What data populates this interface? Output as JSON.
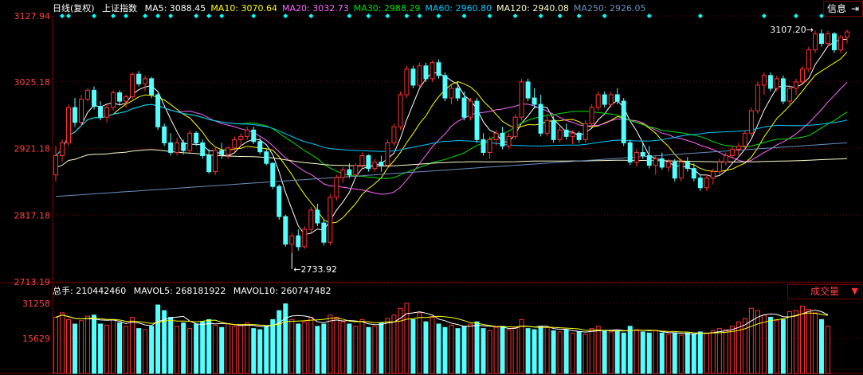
{
  "header": {
    "period_label": "日线(复权)",
    "index_name": "上证指数",
    "ma": [
      {
        "label": "MA5: 3088.45",
        "color": "#ffffff"
      },
      {
        "label": "MA10: 3070.64",
        "color": "#ffff00"
      },
      {
        "label": "MA20: 3032.73",
        "color": "#ff66ff"
      },
      {
        "label": "MA30: 2988.29",
        "color": "#00e000"
      },
      {
        "label": "MA60: 2960.80",
        "color": "#00c8ff"
      },
      {
        "label": "MA120: 2940.08",
        "color": "#ffffcc"
      },
      {
        "label": "MA250: 2926.05",
        "color": "#6a8fbf"
      }
    ],
    "info_button": "信息",
    "info_icon": "exit-arrow-icon"
  },
  "volume_header": {
    "total": "总手: 210442460",
    "mavol5": "MAVOL5: 268181922",
    "mavol10": "MAVOL10: 260747482",
    "selector_label": "成交量",
    "selector_icon": "dropdown-triangle-icon"
  },
  "colors": {
    "up": "#ff3232",
    "down": "#54ffff",
    "grid": "#7a0000",
    "axis_text": "#ff4040",
    "bg": "#000000",
    "marker": "#00ffff"
  },
  "chart_data": [
    {
      "type": "candlestick",
      "title": "上证指数",
      "y_ticks": [
        "3127.94",
        "3025.18",
        "2921.18",
        "2817.18",
        "2713.19"
      ],
      "ylim": [
        2713.19,
        3127.94
      ],
      "annotations": [
        {
          "label": "3107.20",
          "kind": "high"
        },
        {
          "label": "2733.92",
          "kind": "low"
        }
      ],
      "ohlc": [
        [
          2880,
          2925,
          2870,
          2910
        ],
        [
          2910,
          2935,
          2900,
          2930
        ],
        [
          2930,
          2990,
          2925,
          2985
        ],
        [
          2985,
          3000,
          2955,
          2962
        ],
        [
          2962,
          3005,
          2955,
          2998
        ],
        [
          2998,
          3015,
          2995,
          3012
        ],
        [
          3012,
          3018,
          2982,
          2987
        ],
        [
          2987,
          2995,
          2965,
          2970
        ],
        [
          2970,
          2990,
          2962,
          2985
        ],
        [
          2985,
          3012,
          2980,
          3008
        ],
        [
          3008,
          3012,
          2990,
          2995
        ],
        [
          2995,
          3005,
          2985,
          3002
        ],
        [
          3002,
          3040,
          2998,
          3037
        ],
        [
          3037,
          3042,
          3018,
          3022
        ],
        [
          3022,
          3035,
          3010,
          3030
        ],
        [
          3030,
          3033,
          3000,
          3005
        ],
        [
          3005,
          3008,
          2950,
          2955
        ],
        [
          2955,
          2960,
          2925,
          2930
        ],
        [
          2930,
          2945,
          2910,
          2915
        ],
        [
          2915,
          2938,
          2910,
          2930
        ],
        [
          2930,
          2935,
          2912,
          2918
        ],
        [
          2918,
          2950,
          2915,
          2945
        ],
        [
          2945,
          2948,
          2925,
          2930
        ],
        [
          2930,
          2935,
          2905,
          2910
        ],
        [
          2910,
          2920,
          2882,
          2885
        ],
        [
          2885,
          2925,
          2880,
          2918
        ],
        [
          2918,
          2930,
          2905,
          2912
        ],
        [
          2912,
          2925,
          2905,
          2922
        ],
        [
          2922,
          2940,
          2915,
          2935
        ],
        [
          2935,
          2945,
          2925,
          2940
        ],
        [
          2940,
          2955,
          2935,
          2950
        ],
        [
          2950,
          2955,
          2928,
          2932
        ],
        [
          2932,
          2938,
          2912,
          2916
        ],
        [
          2916,
          2920,
          2895,
          2898
        ],
        [
          2898,
          2900,
          2858,
          2862
        ],
        [
          2862,
          2865,
          2810,
          2815
        ],
        [
          2815,
          2818,
          2768,
          2772
        ],
        [
          2772,
          2790,
          2758,
          2785
        ],
        [
          2785,
          2795,
          2762,
          2768
        ],
        [
          2768,
          2800,
          2765,
          2795
        ],
        [
          2795,
          2830,
          2790,
          2825
        ],
        [
          2825,
          2835,
          2800,
          2805
        ],
        [
          2805,
          2810,
          2770,
          2775
        ],
        [
          2775,
          2850,
          2770,
          2845
        ],
        [
          2845,
          2880,
          2840,
          2876
        ],
        [
          2876,
          2892,
          2868,
          2888
        ],
        [
          2888,
          2898,
          2875,
          2880
        ],
        [
          2880,
          2898,
          2878,
          2895
        ],
        [
          2895,
          2915,
          2890,
          2910
        ],
        [
          2910,
          2912,
          2885,
          2890
        ],
        [
          2890,
          2905,
          2885,
          2900
        ],
        [
          2900,
          2910,
          2885,
          2895
        ],
        [
          2895,
          2935,
          2890,
          2930
        ],
        [
          2930,
          2960,
          2925,
          2955
        ],
        [
          2955,
          3010,
          2950,
          3005
        ],
        [
          3005,
          3050,
          3000,
          3045
        ],
        [
          3045,
          3050,
          3015,
          3020
        ],
        [
          3020,
          3055,
          3015,
          3050
        ],
        [
          3050,
          3055,
          3025,
          3030
        ],
        [
          3030,
          3058,
          3025,
          3055
        ],
        [
          3055,
          3060,
          3030,
          3035
        ],
        [
          3035,
          3040,
          2995,
          3000
        ],
        [
          3000,
          3020,
          2990,
          3015
        ],
        [
          3015,
          3025,
          2995,
          3000
        ],
        [
          3000,
          3010,
          2965,
          2970
        ],
        [
          2970,
          3000,
          2965,
          2995
        ],
        [
          2995,
          3000,
          2930,
          2935
        ],
        [
          2935,
          2945,
          2910,
          2915
        ],
        [
          2915,
          2940,
          2905,
          2935
        ],
        [
          2935,
          2950,
          2925,
          2945
        ],
        [
          2945,
          2955,
          2920,
          2925
        ],
        [
          2925,
          2945,
          2920,
          2940
        ],
        [
          2940,
          2975,
          2935,
          2970
        ],
        [
          2970,
          3030,
          2965,
          3025
        ],
        [
          3025,
          3030,
          2995,
          3000
        ],
        [
          3000,
          3015,
          2985,
          2990
        ],
        [
          2990,
          3005,
          2940,
          2945
        ],
        [
          2945,
          2975,
          2940,
          2965
        ],
        [
          2965,
          2972,
          2930,
          2935
        ],
        [
          2935,
          2955,
          2930,
          2950
        ],
        [
          2950,
          2960,
          2935,
          2940
        ],
        [
          2940,
          2950,
          2928,
          2945
        ],
        [
          2945,
          2948,
          2930,
          2935
        ],
        [
          2935,
          2965,
          2930,
          2960
        ],
        [
          2960,
          2990,
          2955,
          2985
        ],
        [
          2985,
          3010,
          2980,
          3005
        ],
        [
          3005,
          3010,
          2985,
          2990
        ],
        [
          2990,
          3010,
          2985,
          3005
        ],
        [
          3005,
          3015,
          2990,
          2995
        ],
        [
          2995,
          3000,
          2925,
          2930
        ],
        [
          2930,
          2935,
          2895,
          2900
        ],
        [
          2900,
          2920,
          2893,
          2915
        ],
        [
          2915,
          2930,
          2905,
          2910
        ],
        [
          2910,
          2925,
          2890,
          2895
        ],
        [
          2895,
          2910,
          2880,
          2905
        ],
        [
          2905,
          2915,
          2888,
          2892
        ],
        [
          2892,
          2905,
          2885,
          2900
        ],
        [
          2900,
          2905,
          2870,
          2875
        ],
        [
          2875,
          2905,
          2870,
          2900
        ],
        [
          2900,
          2908,
          2885,
          2890
        ],
        [
          2890,
          2898,
          2870,
          2875
        ],
        [
          2875,
          2880,
          2855,
          2860
        ],
        [
          2860,
          2880,
          2855,
          2875
        ],
        [
          2875,
          2890,
          2865,
          2885
        ],
        [
          2885,
          2905,
          2880,
          2900
        ],
        [
          2900,
          2915,
          2895,
          2910
        ],
        [
          2910,
          2925,
          2905,
          2920
        ],
        [
          2920,
          2930,
          2910,
          2925
        ],
        [
          2925,
          2950,
          2920,
          2945
        ],
        [
          2945,
          2985,
          2940,
          2980
        ],
        [
          2980,
          3025,
          2975,
          3020
        ],
        [
          3020,
          3040,
          3005,
          3035
        ],
        [
          3035,
          3040,
          3010,
          3015
        ],
        [
          3015,
          3035,
          3010,
          3030
        ],
        [
          3030,
          3035,
          2990,
          2995
        ],
        [
          2995,
          3020,
          2990,
          3015
        ],
        [
          3015,
          3030,
          3005,
          3025
        ],
        [
          3025,
          3050,
          3020,
          3045
        ],
        [
          3045,
          3080,
          3040,
          3075
        ],
        [
          3075,
          3105,
          3070,
          3100
        ],
        [
          3100,
          3107,
          3080,
          3085
        ],
        [
          3085,
          3105,
          3080,
          3100
        ],
        [
          3100,
          3103,
          3070,
          3075
        ],
        [
          3075,
          3098,
          3070,
          3095
        ],
        [
          3095,
          3107,
          3085,
          3103
        ]
      ],
      "ma_lines": [
        {
          "name": "MA5",
          "color": "#ffffff"
        },
        {
          "name": "MA10",
          "color": "#ffff00"
        },
        {
          "name": "MA20",
          "color": "#ff66ff"
        },
        {
          "name": "MA30",
          "color": "#00e000"
        },
        {
          "name": "MA60",
          "color": "#00c8ff"
        },
        {
          "name": "MA120",
          "color": "#ffffcc"
        },
        {
          "name": "MA250",
          "color": "#6a8fbf"
        }
      ]
    },
    {
      "type": "bar",
      "y_ticks": [
        "31258",
        "15629"
      ],
      "ylim": [
        0,
        33000
      ],
      "volumes": [
        25000,
        27000,
        24000,
        22000,
        23500,
        25500,
        26000,
        22000,
        21500,
        24000,
        22500,
        21000,
        25000,
        20000,
        19500,
        21000,
        30500,
        28000,
        25000,
        21000,
        22500,
        20000,
        22000,
        23000,
        24000,
        21500,
        20500,
        22000,
        21000,
        21500,
        22500,
        20000,
        19500,
        21000,
        24000,
        28000,
        31000,
        24000,
        22000,
        23000,
        25000,
        21000,
        22000,
        26000,
        25000,
        23000,
        22000,
        21000,
        24000,
        20500,
        21000,
        22500,
        24500,
        26000,
        29000,
        31258,
        24000,
        27000,
        23000,
        25000,
        22000,
        20500,
        21500,
        20000,
        21000,
        22000,
        23000,
        20000,
        19000,
        20500,
        21000,
        19500,
        20500,
        24000,
        20000,
        19500,
        21000,
        20500,
        19000,
        18500,
        19500,
        18000,
        18500,
        17500,
        20000,
        21000,
        19000,
        18500,
        19000,
        18000,
        21000,
        19500,
        18500,
        18000,
        19000,
        18000,
        17500,
        18000,
        17000,
        18000,
        17500,
        18500,
        18000,
        19000,
        20000,
        19500,
        21000,
        23000,
        24500,
        29000,
        28000,
        26000,
        25000,
        23500,
        24000,
        27500,
        28000,
        30000,
        28500,
        27000,
        24000,
        21000
      ]
    }
  ]
}
